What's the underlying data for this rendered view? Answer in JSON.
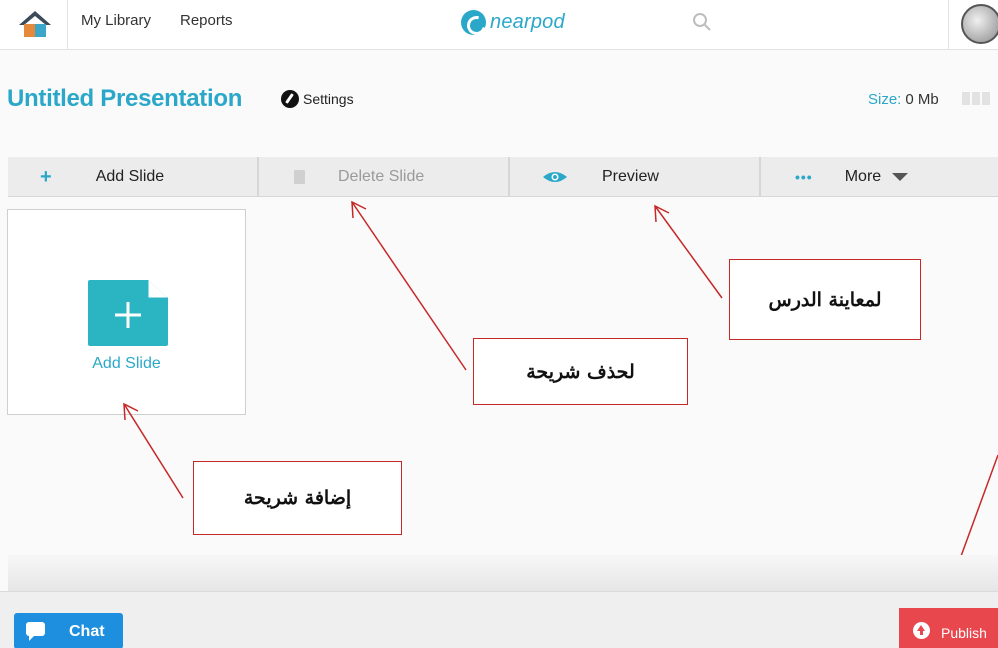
{
  "nav": {
    "links": [
      "My Library",
      "Reports"
    ],
    "logo_text": "nearpod",
    "icons": [
      "home-icon",
      "search-icon",
      "avatar-globe"
    ]
  },
  "header": {
    "title": "Untitled Presentation",
    "settings_label": "Settings",
    "size_label": "Size:",
    "size_value": "0 Mb"
  },
  "toolbar": {
    "add_slide": "Add Slide",
    "delete_slide": "Delete Slide",
    "preview": "Preview",
    "more": "More"
  },
  "slide_card": {
    "label": "Add Slide"
  },
  "annotations": {
    "preview_note": "لمعاينة الدرس",
    "delete_note": "لحذف شريحة",
    "add_note": "إضافة شريحة"
  },
  "footer": {
    "chat_label": "Chat",
    "publish_label": "Publish"
  },
  "colors": {
    "accent": "#2ba8c9",
    "publish": "#e8474d",
    "chat": "#1d8fde",
    "annotation": "#c62828"
  }
}
